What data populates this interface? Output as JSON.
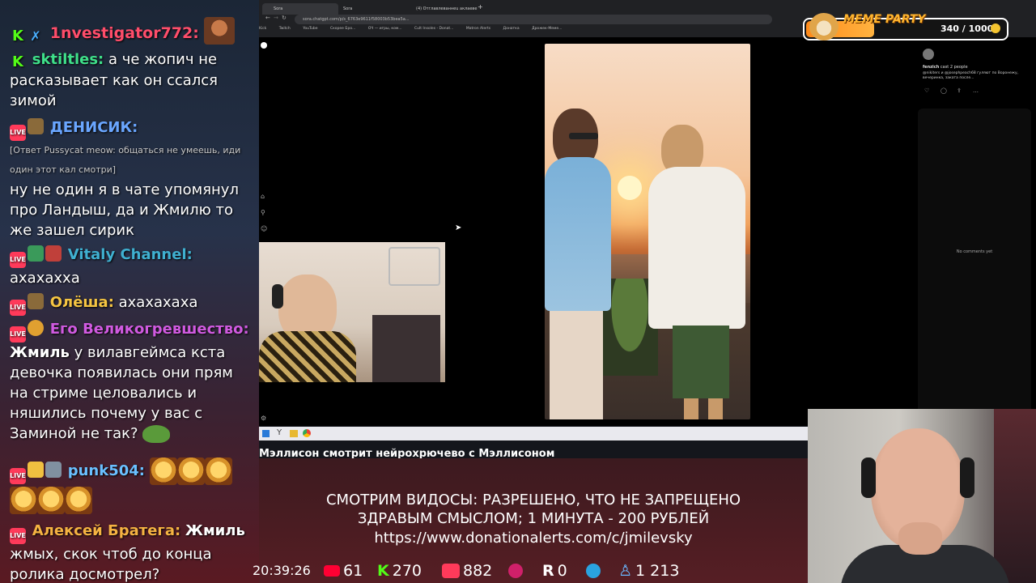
{
  "chat": {
    "messages": [
      {
        "user": "1nvestigator772:",
        "text": "",
        "color": "#ff4d6a"
      },
      {
        "user": "sktiltles:",
        "text": "а че жопич не расказывает как он ссался зимой",
        "color": "#3fe08a"
      },
      {
        "user": "ДЕНИСИК:",
        "reply": "[Ответ Pussycat meow: общаться не умеешь, иди один этот кал смотри]",
        "text": "ну не один я в чате упомянул про Ландыш, да и Жмилю то же зашел сирик",
        "color": "#6aa6ff"
      },
      {
        "user": "Vitaly Channel:",
        "text": "ахахаххa",
        "color": "#3fb0d0"
      },
      {
        "user": "Олёша:",
        "text": "ахахахаха",
        "color": "#f5c542"
      },
      {
        "user": "Его Великогревшество:",
        "mention": "Жмиль",
        "text": "у вилавгеймса кста девочка появилась они прям на стриме целовались и няшились почему у вас с Заминой не так?",
        "color": "#d05ae0"
      },
      {
        "user": "punk504:",
        "text": "",
        "color": "#6ac0ff"
      },
      {
        "user": "Алексей Братега:",
        "mention": "Жмиль",
        "text": "жмых, скок чтоб до конца ролика досмотрел?",
        "color": "#f5b342"
      }
    ]
  },
  "browser": {
    "tabs": [
      "Sora",
      "Sora",
      "(4) Отглавлеваннeu аклаеве"
    ],
    "url": "sora.chatgpt.com/p/s_6763e9611f58003b53bea5a...",
    "bookmarks": [
      "Kick",
      "Twitch",
      "YouTube",
      "Скорее Бро...",
      "ОЧ — игры, ком...",
      "Cult Insoles - Donat...",
      "Matron Alerts",
      "Донатка",
      "Дрожек-Меме..."
    ]
  },
  "right_panel": {
    "author": "fenzich",
    "meta": "cast 2 people",
    "caption": "@nikiters и @josephpeach68 гуляют по Воронежу, вечеринка, заката после...",
    "no_comments": "No comments yet"
  },
  "video_title": "Мэллисон смотрит нейрохрючево с Мэллисоном",
  "banner": {
    "line1": "СМОТРИМ ВИДОСЫ: РАЗРЕШЕНО, ЧТО НЕ ЗАПРЕЩЕНО",
    "line2": "ЗДРАВЫМ СМЫСЛОМ; 1 МИНУТА - 200 РУБЛЕЙ",
    "line3": "https://www.donationalerts.com/c/jmilevsky"
  },
  "stats": {
    "time": "20:39:26",
    "youtube": "61",
    "kick": "270",
    "vk_live": "882",
    "rutube": "0",
    "rumble": "0",
    "telegram": "1 213"
  },
  "meme_party": {
    "title": "MEME PARTY",
    "progress_text": "340 / 1000",
    "progress": 0.34
  },
  "colors": {
    "kick": "#53fc18",
    "youtube": "#ff0033",
    "vk": "#ff3a5a",
    "telegram": "#2aa3e0"
  }
}
